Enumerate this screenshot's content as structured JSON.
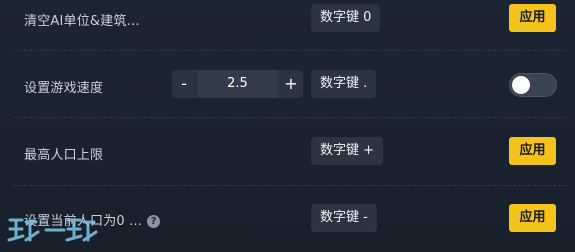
{
  "rows": [
    {
      "label": "清空AI单位&建筑...",
      "key": "数字键 0",
      "action": "应用"
    },
    {
      "label": "设置游戏速度",
      "stepper": {
        "minus": "-",
        "value": "2.5",
        "plus": "+"
      },
      "key": "数字键 .",
      "toggle_on": false
    },
    {
      "label": "最高人口上限",
      "key": "数字键 +",
      "action": "应用"
    },
    {
      "label": "设置当前人口为0 ...",
      "help": "?",
      "key": "数字键 -",
      "action": "应用"
    }
  ],
  "watermark": "玩一玩",
  "colors": {
    "background": "#1a2230",
    "chip": "#2b3442",
    "accent": "#f4c319"
  }
}
